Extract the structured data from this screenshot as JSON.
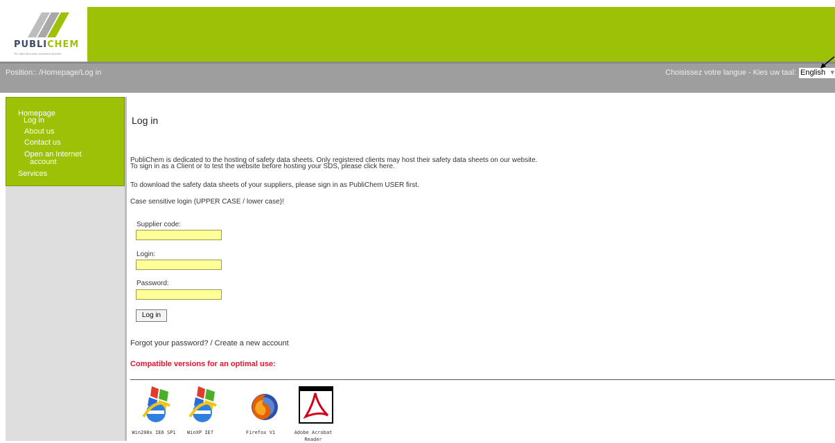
{
  "brand": {
    "logo_text_left": "PUBLI",
    "logo_text_right": "CHEM",
    "tagline": "The right document anywhere anytime"
  },
  "posbar": {
    "position": "Position:: /Homepage/Log in",
    "language_label": "Choisissez votre langue - Kies uw taal:",
    "language_value": "English"
  },
  "sidebar": {
    "items": [
      {
        "label": "Homepage"
      },
      {
        "label": "Log in"
      },
      {
        "label": "About us"
      },
      {
        "label": "Contact us"
      },
      {
        "label": "Open an Internet"
      },
      {
        "label": "account"
      },
      {
        "label": "Services"
      }
    ]
  },
  "main": {
    "title": "Log in",
    "intro_line1": "PubliChem is dedicated to the hosting of safety data sheets. Only registered clients may host their safety data sheets on our website.",
    "intro_line2": "To sign in as a Client or to test the website before hosting your SDS, please click here.",
    "download_line": "To download the safety data sheets of your suppliers, please sign in as PubliChem USER first.",
    "case_line": "Case sensitive login (UPPER CASE / lower case)!",
    "form": {
      "supplier_label": "Supplier code:",
      "supplier_value": "",
      "login_label": "Login:",
      "login_value": "",
      "password_label": "Password:",
      "password_value": "",
      "submit_label": "Log in"
    },
    "links_line": "Forgot your password? / Create a new account",
    "compat_heading": "Compatible versions for an optimal use:",
    "browsers": [
      {
        "caption": "Win200x IE6 SP1",
        "icon": "ie-icon"
      },
      {
        "caption": "WinXP IE7",
        "icon": "ie-icon"
      },
      {
        "caption": "Firefox V1",
        "icon": "firefox-icon"
      },
      {
        "caption": "Adobe Acrobat Reader",
        "icon": "acrobat-icon"
      }
    ]
  },
  "colors": {
    "brand_green": "#9cc107",
    "bar_gray": "#9e9e9e",
    "input_yellow": "#ffff99",
    "alert_red": "#e8112d"
  }
}
